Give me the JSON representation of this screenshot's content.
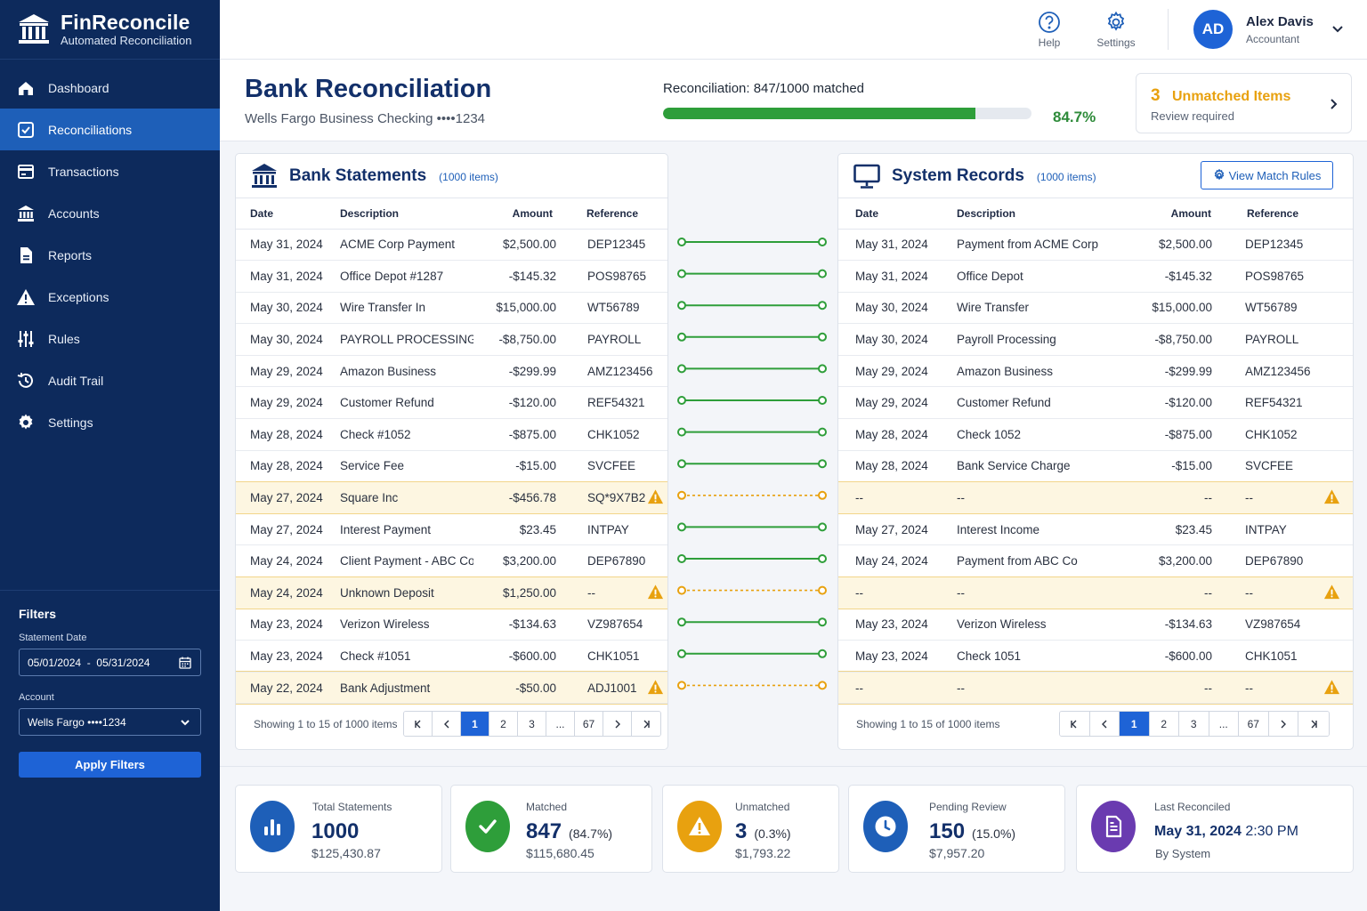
{
  "app": {
    "title": "FinReconcile",
    "subtitle": "Automated Reconciliation"
  },
  "nav": [
    {
      "label": "Dashboard",
      "icon": "home-icon",
      "active": false
    },
    {
      "label": "Reconciliations",
      "icon": "reconcile-icon",
      "active": true
    },
    {
      "label": "Transactions",
      "icon": "transactions-icon",
      "active": false
    },
    {
      "label": "Accounts",
      "icon": "bank-icon",
      "active": false
    },
    {
      "label": "Reports",
      "icon": "report-icon",
      "active": false
    },
    {
      "label": "Exceptions",
      "icon": "warning-icon",
      "active": false
    },
    {
      "label": "Rules",
      "icon": "sliders-icon",
      "active": false
    },
    {
      "label": "Audit Trail",
      "icon": "history-icon",
      "active": false
    },
    {
      "label": "Settings",
      "icon": "gear-icon",
      "active": false
    }
  ],
  "filters": {
    "title": "Filters",
    "date_label": "Statement Date",
    "date_value": "05/01/2024  -  05/31/2024",
    "account_label": "Account",
    "account_value": "Wells Fargo ••••1234",
    "apply_label": "Apply Filters"
  },
  "topbar": {
    "help_label": "Help",
    "settings_label": "Settings",
    "user_initials": "AD",
    "user_name": "Alex Davis",
    "user_role": "Accountant"
  },
  "header": {
    "title": "Bank Reconciliation",
    "subtitle": "Wells Fargo Business Checking ••••1234",
    "recon_prefix": "Reconciliation: 847/1000",
    "recon_suffix": "matched",
    "progress_fraction": 0.847,
    "percent": "84.7%",
    "unmatched_count": "3",
    "unmatched_title": "Unmatched Items",
    "unmatched_sub": "Review required"
  },
  "bank": {
    "title": "Bank Statements",
    "count": "(1000 items)",
    "columns": [
      "Date",
      "Description",
      "Amount",
      "Reference"
    ],
    "rows": [
      [
        "May 31, 2024",
        "ACME Corp Payment",
        "$2,500.00",
        "DEP12345",
        false
      ],
      [
        "May 31, 2024",
        "Office Depot #1287",
        "-$145.32",
        "POS98765",
        false
      ],
      [
        "May 30, 2024",
        "Wire Transfer In",
        "$15,000.00",
        "WT56789",
        false
      ],
      [
        "May 30, 2024",
        "PAYROLL PROCESSING",
        "-$8,750.00",
        "PAYROLL",
        false
      ],
      [
        "May 29, 2024",
        "Amazon Business",
        "-$299.99",
        "AMZ123456",
        false
      ],
      [
        "May 29, 2024",
        "Customer Refund",
        "-$120.00",
        "REF54321",
        false
      ],
      [
        "May 28, 2024",
        "Check #1052",
        "-$875.00",
        "CHK1052",
        false
      ],
      [
        "May 28, 2024",
        "Service Fee",
        "-$15.00",
        "SVCFEE",
        false
      ],
      [
        "May 27, 2024",
        "Square Inc",
        "-$456.78",
        "SQ*9X7B2",
        true
      ],
      [
        "May 27, 2024",
        "Interest Payment",
        "$23.45",
        "INTPAY",
        false
      ],
      [
        "May 24, 2024",
        "Client Payment - ABC Co",
        "$3,200.00",
        "DEP67890",
        false
      ],
      [
        "May 24, 2024",
        "Unknown Deposit",
        "$1,250.00",
        "--",
        true
      ],
      [
        "May 23, 2024",
        "Verizon Wireless",
        "-$134.63",
        "VZ987654",
        false
      ],
      [
        "May 23, 2024",
        "Check #1051",
        "-$600.00",
        "CHK1051",
        false
      ],
      [
        "May 22, 2024",
        "Bank Adjustment",
        "-$50.00",
        "ADJ1001",
        true
      ]
    ],
    "showing": "Showing 1 to 15 of 1000 items"
  },
  "system": {
    "title": "System Records",
    "count": "(1000 items)",
    "rules_label": "View Match Rules",
    "columns": [
      "Date",
      "Description",
      "Amount",
      "Reference"
    ],
    "rows": [
      [
        "May 31, 2024",
        "Payment from ACME Corp",
        "$2,500.00",
        "DEP12345",
        false
      ],
      [
        "May 31, 2024",
        "Office Depot",
        "-$145.32",
        "POS98765",
        false
      ],
      [
        "May 30, 2024",
        "Wire Transfer",
        "$15,000.00",
        "WT56789",
        false
      ],
      [
        "May 30, 2024",
        "Payroll Processing",
        "-$8,750.00",
        "PAYROLL",
        false
      ],
      [
        "May 29, 2024",
        "Amazon Business",
        "-$299.99",
        "AMZ123456",
        false
      ],
      [
        "May 29, 2024",
        "Customer Refund",
        "-$120.00",
        "REF54321",
        false
      ],
      [
        "May 28, 2024",
        "Check 1052",
        "-$875.00",
        "CHK1052",
        false
      ],
      [
        "May 28, 2024",
        "Bank Service Charge",
        "-$15.00",
        "SVCFEE",
        false
      ],
      [
        "--",
        "--",
        "--",
        "--",
        true
      ],
      [
        "May 27, 2024",
        "Interest Income",
        "$23.45",
        "INTPAY",
        false
      ],
      [
        "May 24, 2024",
        "Payment from ABC Co",
        "$3,200.00",
        "DEP67890",
        false
      ],
      [
        "--",
        "--",
        "--",
        "--",
        true
      ],
      [
        "May 23, 2024",
        "Verizon Wireless",
        "-$134.63",
        "VZ987654",
        false
      ],
      [
        "May 23, 2024",
        "Check 1051",
        "-$600.00",
        "CHK1051",
        false
      ],
      [
        "--",
        "--",
        "--",
        "--",
        true
      ]
    ],
    "showing": "Showing 1 to 15 of 1000 items"
  },
  "pagination": [
    "1",
    "2",
    "3",
    "...",
    "67"
  ],
  "stats": {
    "total": {
      "label": "Total Statements",
      "value": "1000",
      "amount": "$125,430.87"
    },
    "matched": {
      "label": "Matched",
      "value": "847",
      "pct": "(84.7%)",
      "amount": "$115,680.45"
    },
    "unmatched": {
      "label": "Unmatched",
      "value": "3",
      "pct": "(0.3%)",
      "amount": "$1,793.22"
    },
    "pending": {
      "label": "Pending Review",
      "value": "150",
      "pct": "(15.0%)",
      "amount": "$7,957.20"
    },
    "last": {
      "label": "Last Reconciled",
      "date": "May 31, 2024",
      "time": "2:30 PM",
      "by": "By System"
    }
  },
  "colors": {
    "sidebar": "#0d2a5c",
    "accent": "#1e63d6",
    "matched": "#2e9e3a",
    "warning": "#e8a10f",
    "pending": "#1e5fb8",
    "last": "#6a3bb0"
  }
}
